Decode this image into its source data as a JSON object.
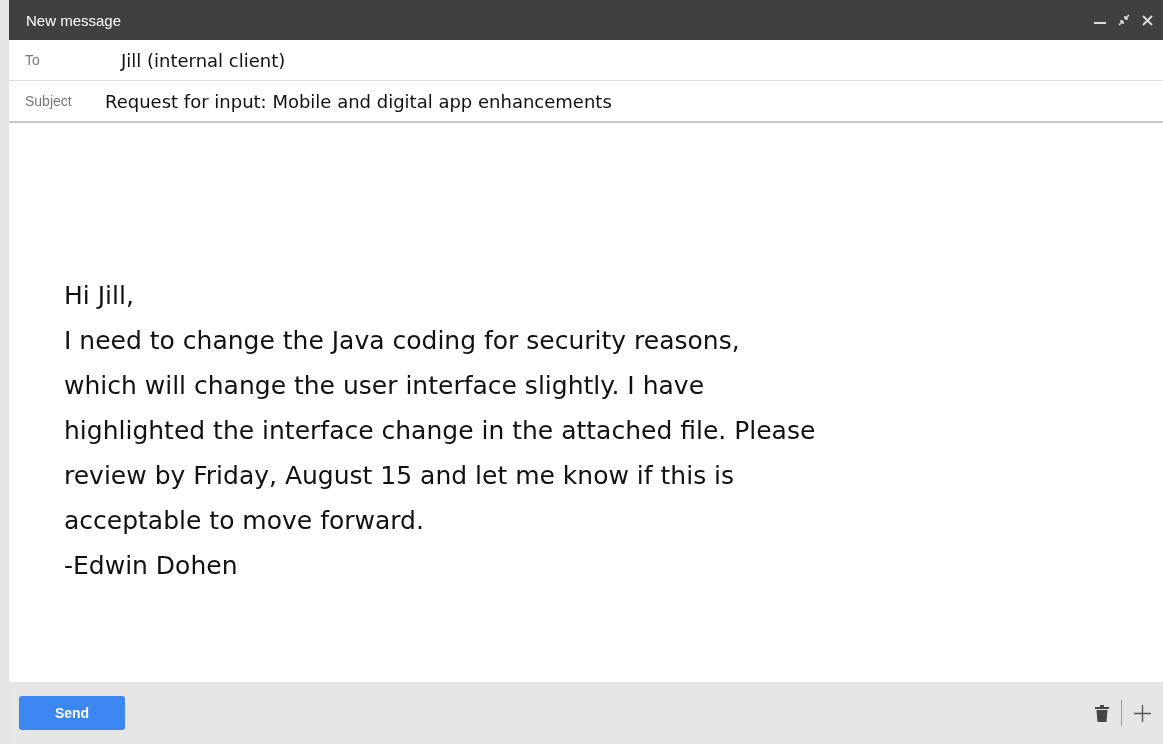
{
  "window": {
    "title": "New message"
  },
  "to": {
    "label": "To",
    "value": "Jill (internal client)"
  },
  "subject": {
    "label": "Subject",
    "value": "Request for input: Mobile and digital app enhancements"
  },
  "body_lines": [
    "Hi Jill,",
    "I need to change the Java coding for security reasons,",
    "which will change the user interface slightly. I have",
    "highlighted the interface change in the attached file. Please",
    "review by Friday, August 15 and let me know if this is",
    "acceptable to move forward.",
    "-Edwin Dohen"
  ],
  "send_button": "Send"
}
